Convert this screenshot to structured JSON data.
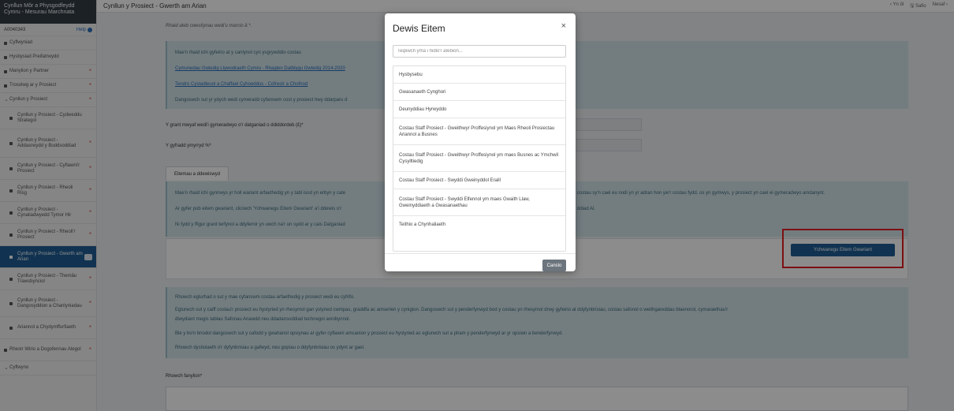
{
  "sidebar": {
    "header_line1": "Cynllun Môr a Physgodfeydd",
    "header_line2": "Cymru - Mesurau Marchnata",
    "ref": "A0040343",
    "help": "Help",
    "items": [
      {
        "label": "Cyflwyniad",
        "sub": false,
        "star": false,
        "active": false,
        "chev": false
      },
      {
        "label": "Hysbysiad Preifatrwydd",
        "sub": false,
        "star": false,
        "active": false,
        "chev": false
      },
      {
        "label": "Manylion y Partner",
        "sub": false,
        "star": true,
        "active": false,
        "chev": false
      },
      {
        "label": "Trosolwg ar y Prosiect",
        "sub": false,
        "star": true,
        "active": false,
        "chev": false
      },
      {
        "label": "Cynllun y Prosiect",
        "sub": false,
        "star": true,
        "active": false,
        "chev": true
      },
      {
        "label": "Cynllun y Prosiect - Cydweddu Strategol",
        "sub": true,
        "star": false,
        "active": false,
        "chev": false
      },
      {
        "label": "Cynllun y Prosiect - Addasrwydd y Buddsoddiad",
        "sub": true,
        "star": true,
        "active": false,
        "chev": false
      },
      {
        "label": "Cynllun y Prosiect - Cyflawni'r Prosiect",
        "sub": true,
        "star": true,
        "active": false,
        "chev": false
      },
      {
        "label": "Cynllun y Prosiect - Rheoli Risg",
        "sub": true,
        "star": true,
        "active": false,
        "chev": false
      },
      {
        "label": "Cynllun y Prosiect - Cynaliadwyedd Tymor Hir",
        "sub": true,
        "star": true,
        "active": false,
        "chev": false
      },
      {
        "label": "Cynllun y Prosiect - Rheoli'r Prosiect",
        "sub": true,
        "star": true,
        "active": false,
        "chev": false
      },
      {
        "label": "Cynllun y Prosiect - Gwerth am Arian",
        "sub": true,
        "star": false,
        "active": true,
        "chev": false
      },
      {
        "label": "Cynllun y Prosiect - Themâu Trawsbynciol",
        "sub": true,
        "star": true,
        "active": false,
        "chev": false
      },
      {
        "label": "Cynllun y Prosiect - Dangosyddion a Chanlyniadau",
        "sub": true,
        "star": true,
        "active": false,
        "chev": false
      },
      {
        "label": "Ariannol a Chydymffurfiaeth",
        "sub": true,
        "star": true,
        "active": false,
        "chev": false
      },
      {
        "label": "Rhestr Wirio a Dogofennau Ategol",
        "sub": false,
        "star": true,
        "active": false,
        "chev": false
      },
      {
        "label": "Cyflwyno",
        "sub": false,
        "star": false,
        "active": false,
        "chev": true
      }
    ]
  },
  "topbar": {
    "title": "Cynllun y Prosiect - Gwerth am Arian",
    "nav": [
      "‹ Yn ôl",
      "Safio",
      "Nesaf ›"
    ]
  },
  "main": {
    "required_note": "Rhaid ateb cwestiynau wedi'u marcio â *.",
    "info_lines": [
      "Mae'n rhaid ichi gyfeirio at y canlynol cyn ysgrywddio costau",
      "Cymunedau Gwledig Llywodraeth Cymru - Rhaglen Datblygu Gwledig 2014-2020",
      "Tendro Cystadleuol a Chaffael Cyhoeddus - Cofrestr a Chofnod",
      "Dangoswch sut yr ydych wedi cymeradd cyfanswm cost y prosiect hwy ddarparu d"
    ],
    "field1_label": "Y grant mwyaf wedi'i gymeradwyo o'r datganiad o ddiddordeb (£)*",
    "field2_label": "Y gyfradd ymyrryd %*",
    "tab_label": "Eitemau a ddewiswyd",
    "expenditure_lines": [
      "Mae'n rhaid ichi gynnwys yr holl wariant arfaethedig yn y tabl isod yn erbyn y cate",
      "Ar gyfer pob eitem gwariant, cliciwch 'Ychwanegu Eitem Gwariant' a'i ddewis o'r",
      "Ni fydd y ffigur grant terfynol a ddyfernir yn uwch na'r un sydd ar y cais Datganiad"
    ],
    "expenditure_right_1": "costau sy'n cael eu nodi yn yr adran hon yw'r costau fydd, os yn gymwys, y prosiect yn cael ei gymeradwyo amdanynt.",
    "expenditure_right_2": "ddiad Al.",
    "add_button": "Ychwanegu Eitem Gwariant",
    "justification_lines": [
      "Rhowch eglurhad o sut y mae cyfanswm costau arfaethedig y prosiect wedi eu cyfrifo.",
      "Eglurwch sut y caiff costau'r prosiect eu hystyried yn rhesymol gan ystyried cwmpas, graddfa ac amserlen y cynigion. Dangoswch sut y penderfynwyd bod y costau yn rhesymol drwy gyfeirio at ddyfynbrisiau, costau safonol o weithgareddau blaenorol, cymaraethau'r",
      "diwydiant megis tablau Safonau Anawdd neu ddadansoddiad technegol annibynnol.",
      "Ble y bo'n briodol dangoswch sut y cafodd y gwahanol opsiynau ar gyfer cyflawni amcanion y prosiect eu hystyried ac eglurwch sut a pham y penderfynwyd ar yr opsiwn a benderfynwyd.",
      "Rhowch dystiolaeth o'r dyfynbrisiau a gafwyd, neu gopïau o ddyfynbrisiau os ydynt ar gael."
    ],
    "details_label": "Rhowch fanylion*"
  },
  "modal": {
    "title": "Dewis Eitem",
    "close": "×",
    "search_placeholder": "Teipiwch yma i hidlo'r atebion...",
    "items": [
      "Hysbysebu",
      "Gwasanaeth Cynghori",
      "Deunyddiau Hyrwyddo",
      "Costau Staff Prosiect - Gweithwyr Proffesiynol ym Maes Rheoli Prosiectau Ariannol a Busnes",
      "Costau Staff Prosiect - Gweithwyr Proffesiynol ym maes Busnes ac Ymchwil Cysylltiedig",
      "Costau Staff Prosiect - Swyddi Gweinyddol Eraill",
      "Costau Staff Prosiect - Swyddi Elfennol ym maes Gwaith Llaw, Gweinyddiaeth a Gwasanaethau",
      "Teithio a Chynhaliaeth"
    ],
    "cancel": "Canslo"
  },
  "colors": {
    "accent": "#1f5d94",
    "sidebar_header": "#333c46",
    "info_bg": "#d2e4ea",
    "highlight_frame": "#e31e24"
  }
}
